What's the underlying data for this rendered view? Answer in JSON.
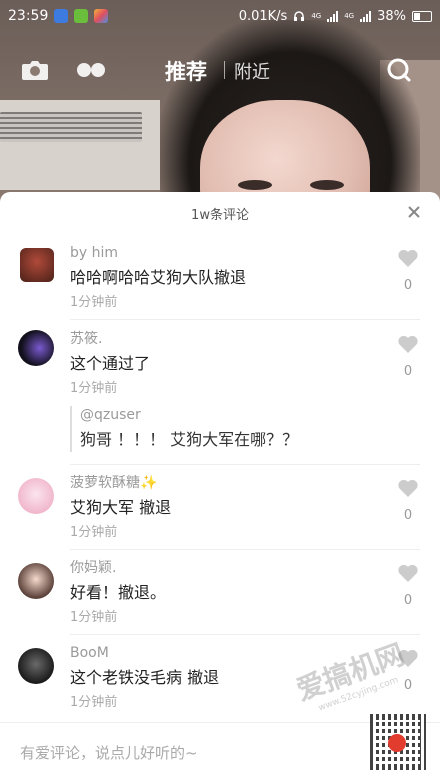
{
  "status_bar": {
    "time": "23:59",
    "network_speed": "0.01K/s",
    "battery": "38%",
    "signal_label_1": "4G",
    "signal_label_2": "4G"
  },
  "top_nav": {
    "tab_recommend": "推荐",
    "tab_nearby": "附近",
    "icons": [
      "camera-icon",
      "dots-icon",
      "search-icon"
    ]
  },
  "comment_panel": {
    "title": "1w条评论",
    "comments": [
      {
        "username": "by him",
        "text": "哈哈啊哈哈艾狗大队撤退",
        "time": "1分钟前",
        "likes": "0"
      },
      {
        "username": "苏筱.",
        "text": "这个通过了",
        "time": "1分钟前",
        "likes": "0",
        "reply": {
          "user": "@qzuser",
          "text": "狗哥 ！！！ 艾狗大军在哪？？"
        }
      },
      {
        "username": "菠萝软酥糖✨",
        "text": "艾狗大军 撤退",
        "time": "1分钟前",
        "likes": "0"
      },
      {
        "username": "你妈颖.",
        "text": "好看！撤退。",
        "time": "1分钟前",
        "likes": "0"
      },
      {
        "username": "BooM",
        "text": "这个老铁没毛病 撤退",
        "time": "1分钟前",
        "likes": "0"
      }
    ],
    "input_placeholder": "有爱评论，说点儿好听的~"
  },
  "watermark_text": "爱搞机网",
  "watermark_url": "www.52cyjing.com",
  "colors": {
    "panel_bg": "#ffffff",
    "username": "#9a9a9a",
    "text": "#222222",
    "like_icon": "#cccccc"
  }
}
